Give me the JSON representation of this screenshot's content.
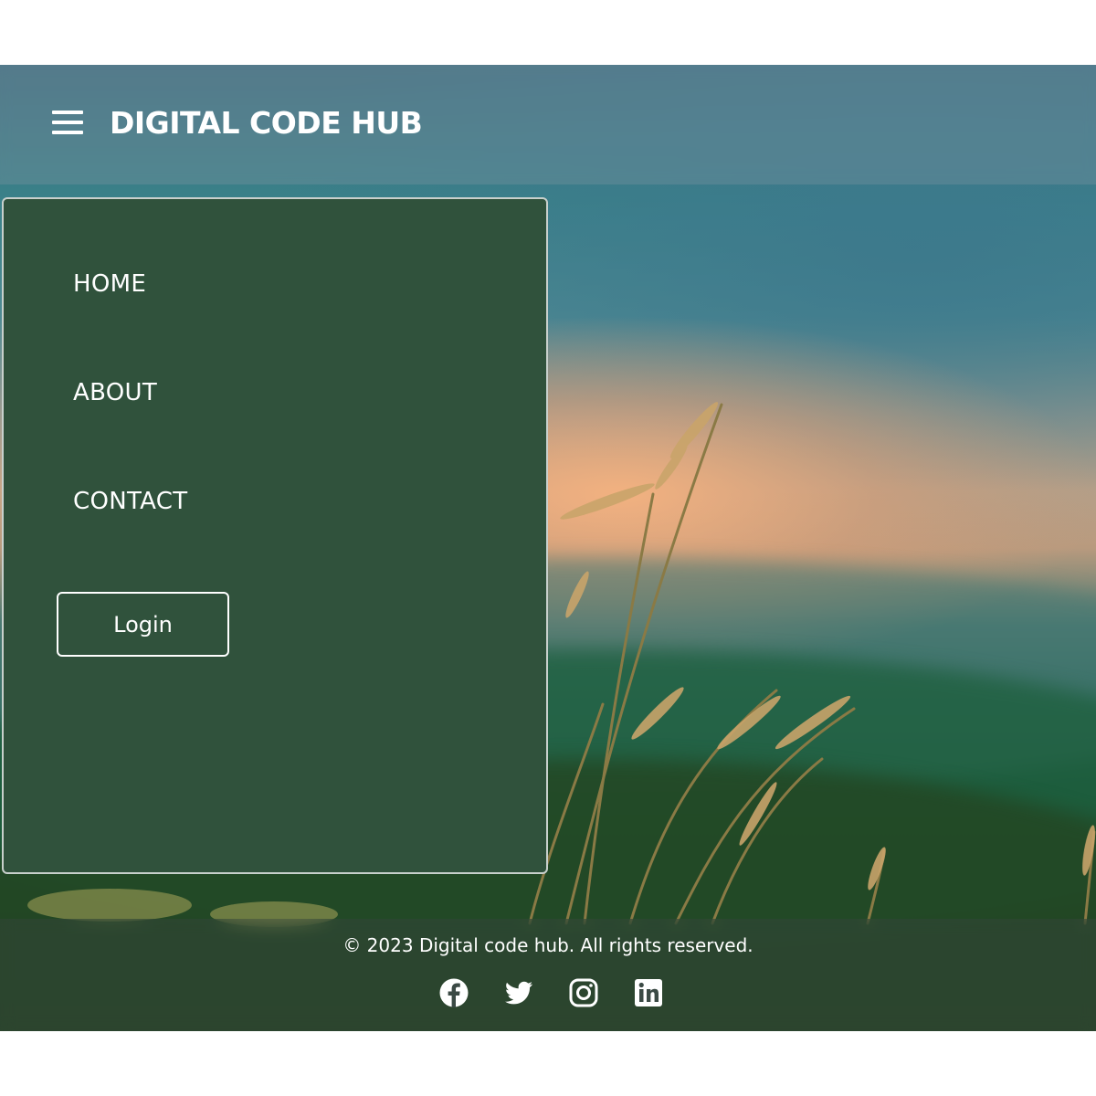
{
  "header": {
    "brand": "DIGITAL CODE HUB",
    "menu_icon": "hamburger-menu-icon"
  },
  "nav": {
    "items": [
      {
        "label": "HOME"
      },
      {
        "label": "ABOUT"
      },
      {
        "label": "CONTACT"
      }
    ],
    "login_label": "Login"
  },
  "footer": {
    "copyright": "© 2023 Digital code hub. All rights reserved.",
    "social_icons": [
      "facebook-icon",
      "twitter-icon",
      "instagram-icon",
      "linkedin-icon"
    ]
  },
  "colors": {
    "drawer_bg": "#30523c",
    "text": "#ffffff"
  }
}
